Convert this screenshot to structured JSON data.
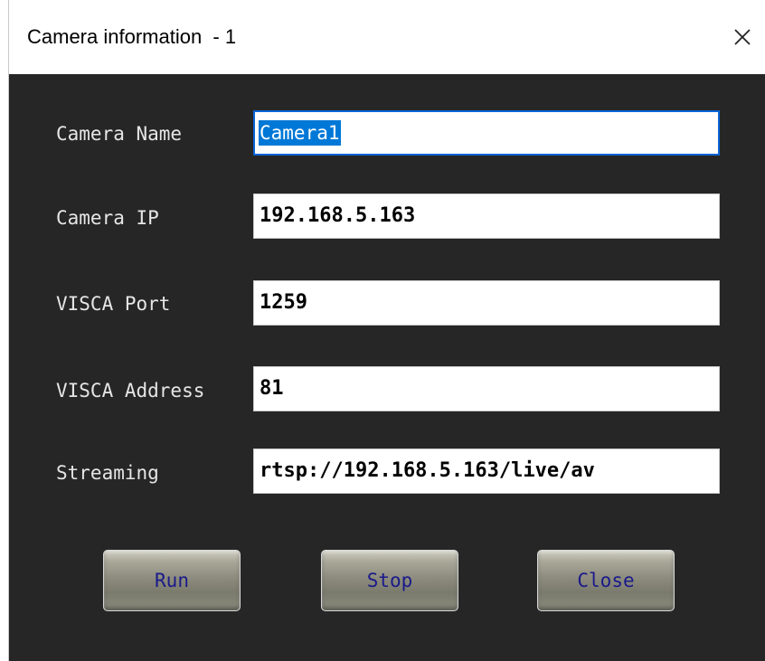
{
  "window": {
    "title": "Camera information  - 1"
  },
  "fields": [
    {
      "label": "Camera Name",
      "value": "Camera1"
    },
    {
      "label": "Camera IP",
      "value": "192.168.5.163"
    },
    {
      "label": "VISCA Port",
      "value": "1259"
    },
    {
      "label": "VISCA Address",
      "value": "81"
    },
    {
      "label": "Streaming",
      "value": "rtsp://192.168.5.163/live/av"
    }
  ],
  "buttons": {
    "run": "Run",
    "stop": "Stop",
    "close": "Close"
  },
  "colors": {
    "background": "#262626",
    "selection": "#0078d7",
    "button_text": "#1a1a8a"
  }
}
